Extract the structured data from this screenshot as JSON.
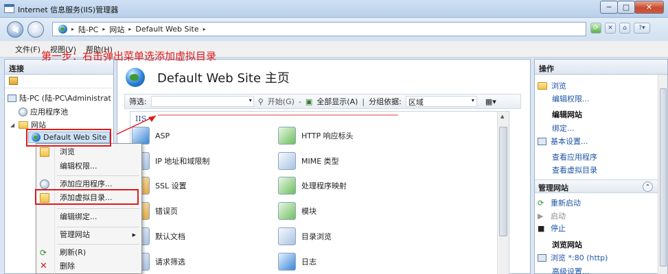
{
  "window": {
    "title": "Internet 信息服务(IIS)管理器",
    "minimize": "─",
    "maximize": "□",
    "close": "✕"
  },
  "address": {
    "crumbs": [
      "陆-PC",
      "网站",
      "Default Web Site"
    ],
    "sep": "▸"
  },
  "menu": [
    "文件(F)",
    "视图(V)",
    "帮助(H)"
  ],
  "connections": {
    "header": "连接",
    "tree": {
      "server": "陆-PC (陆-PC\\Administrat",
      "app_pools": "应用程序池",
      "sites": "网站",
      "default_site": "Default Web Site"
    }
  },
  "main": {
    "title": "Default Web Site 主页",
    "filter_label": "筛选:",
    "start_label": "开始(G)",
    "showall_label": "全部显示(A)",
    "groupby_label": "分组依据:",
    "groupby_value": "区域",
    "group_header": "IIS",
    "features": [
      {
        "label": "ASP"
      },
      {
        "label": "HTTP 响应标头"
      },
      {
        "label": "IP 地址和域限制"
      },
      {
        "label": "MIME 类型"
      },
      {
        "label": "SSL 设置"
      },
      {
        "label": "处理程序映射"
      },
      {
        "label": "错误页"
      },
      {
        "label": "模块"
      },
      {
        "label": "默认文档"
      },
      {
        "label": "目录浏览"
      },
      {
        "label": "请求筛选"
      },
      {
        "label": "日志"
      }
    ]
  },
  "annotation": "第一步：右击弹出菜单选添加虚拟目录",
  "context_menu": {
    "items": [
      "浏览",
      "编辑权限...",
      "添加应用程序...",
      "添加虚拟目录...",
      "编辑绑定...",
      "管理网站",
      "刷新(R)",
      "删除"
    ]
  },
  "actions": {
    "header": "操作",
    "browse": "浏览",
    "edit_perms": "编辑权限...",
    "edit_site": "编辑网站",
    "bindings": "绑定...",
    "basic_settings": "基本设置...",
    "view_apps": "查看应用程序",
    "view_vdirs": "查看虚拟目录",
    "manage_site": "管理网站",
    "restart": "重新启动",
    "start": "启动",
    "stop": "停止",
    "browse_site": "浏览网站",
    "browse_80": "浏览 *:80 (http)",
    "advanced": "高级设置..."
  },
  "colors": {
    "annotation_red": "#e01818",
    "link_blue": "#1e55a6",
    "selection_blue": "#cde3f7"
  }
}
